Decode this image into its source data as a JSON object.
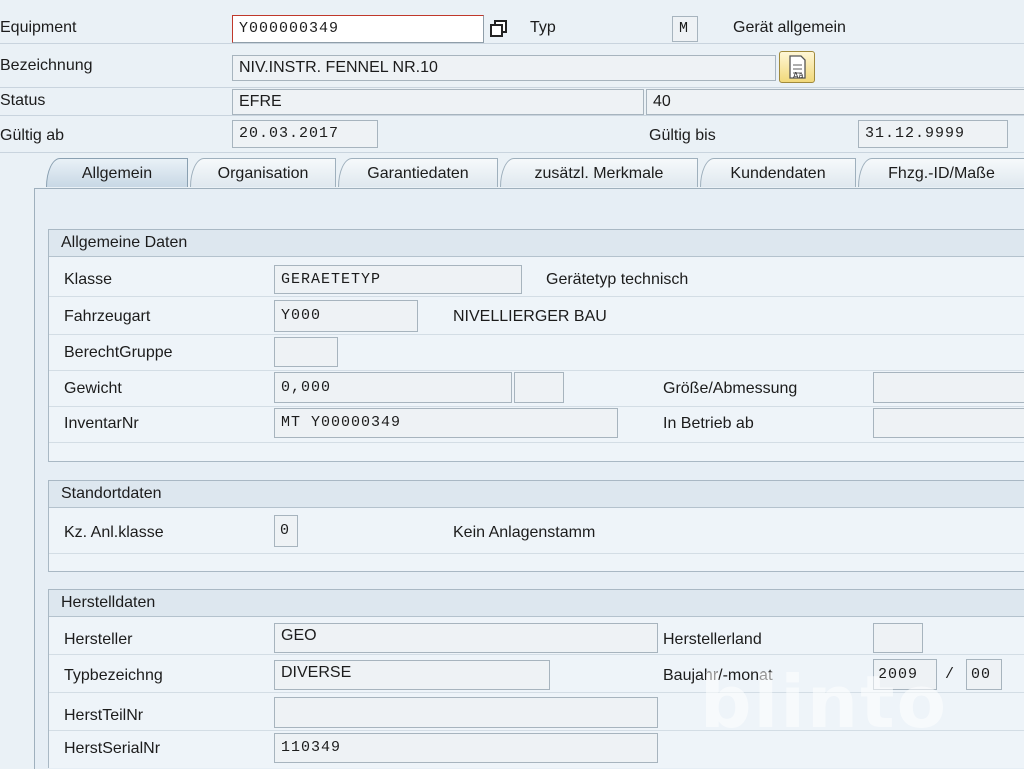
{
  "header": {
    "equipment_label": "Equipment",
    "equipment_value": "Y000000349",
    "typ_label": "Typ",
    "typ_value": "M",
    "typ_desc": "Gerät allgemein",
    "bezeichnung_label": "Bezeichnung",
    "bezeichnung_value": "NIV.INSTR. FENNEL NR.10",
    "status_label": "Status",
    "status_value": "EFRE",
    "status_value2": "40",
    "gueltig_ab_label": "Gültig ab",
    "gueltig_ab_value": "20.03.2017",
    "gueltig_bis_label": "Gültig bis",
    "gueltig_bis_value": "31.12.9999"
  },
  "tabs": [
    {
      "label": "Allgemein",
      "active": true
    },
    {
      "label": "Organisation"
    },
    {
      "label": "Garantiedaten"
    },
    {
      "label": "zusätzl. Merkmale"
    },
    {
      "label": "Kundendaten"
    },
    {
      "label": "Fhzg.-ID/Maße"
    }
  ],
  "allgemeine_daten": {
    "title": "Allgemeine Daten",
    "klasse_label": "Klasse",
    "klasse_value": "GERAETETYP",
    "klasse_desc": "Gerätetyp technisch",
    "fahrzeugart_label": "Fahrzeugart",
    "fahrzeugart_value": "Y000",
    "fahrzeugart_desc": "NIVELLIERGER BAU",
    "berecht_label": "BerechtGruppe",
    "berecht_value": "",
    "gewicht_label": "Gewicht",
    "gewicht_value": "0,000",
    "gewicht_unit": "",
    "groesse_label": "Größe/Abmessung",
    "groesse_value": "",
    "inventar_label": "InventarNr",
    "inventar_value": "MT Y00000349",
    "inbetrieb_label": "In Betrieb ab",
    "inbetrieb_value": ""
  },
  "standortdaten": {
    "title": "Standortdaten",
    "kz_label": "Kz. Anl.klasse",
    "kz_value": "0",
    "kz_desc": "Kein Anlagenstamm"
  },
  "herstelldaten": {
    "title": "Herstelldaten",
    "hersteller_label": "Hersteller",
    "hersteller_value": "GEO",
    "herstellerland_label": "Herstellerland",
    "herstellerland_value": "",
    "typbez_label": "Typbezeichng",
    "typbez_value": "DIVERSE",
    "baujahr_label": "Baujahr/-monat",
    "baujahr_value": "2009",
    "baujahr_sep": "/",
    "baumonat_value": "00",
    "teilnr_label": "HerstTeilNr",
    "teilnr_value": "",
    "serialnr_label": "HerstSerialNr",
    "serialnr_value": "110349"
  },
  "icons": {
    "copy": "copy-icon",
    "longtext": "long-text-icon"
  },
  "watermark": "blinto"
}
